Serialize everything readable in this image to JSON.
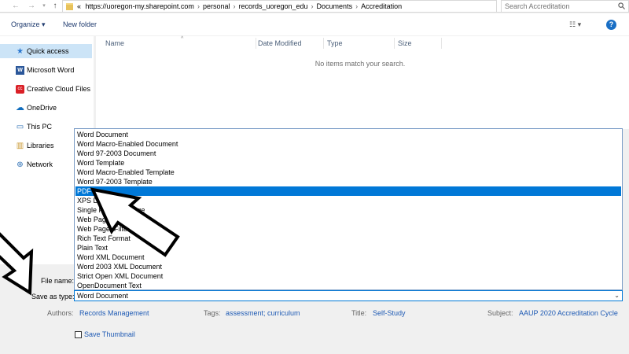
{
  "address": {
    "crumbs": [
      "https://uoregon-my.sharepoint.com",
      "personal",
      "records_uoregon_edu",
      "Documents",
      "Accreditation"
    ],
    "prefix": "«",
    "search_placeholder": "Search Accreditation"
  },
  "toolbar": {
    "organize": "Organize ▾",
    "new_folder": "New folder"
  },
  "sidebar": {
    "items": [
      {
        "label": "Quick access",
        "icon": "star-icon"
      },
      {
        "label": "Microsoft Word",
        "icon": "word-icon"
      },
      {
        "label": "Creative Cloud Files",
        "icon": "creative-cloud-icon"
      },
      {
        "label": "OneDrive",
        "icon": "cloud-icon"
      },
      {
        "label": "This PC",
        "icon": "computer-icon"
      },
      {
        "label": "Libraries",
        "icon": "library-icon"
      },
      {
        "label": "Network",
        "icon": "network-icon"
      }
    ]
  },
  "filelist": {
    "columns": [
      "Name",
      "Date Modified",
      "Type",
      "Size"
    ],
    "empty_message": "No items match your search."
  },
  "dropdown": {
    "options": [
      "Word Document",
      "Word Macro-Enabled Document",
      "Word 97-2003 Document",
      "Word Template",
      "Word Macro-Enabled Template",
      "Word 97-2003 Template",
      "PDF",
      "XPS Document",
      "Single File Web Page",
      "Web Page",
      "Web Page, Filtered",
      "Rich Text Format",
      "Plain Text",
      "Word XML Document",
      "Word 2003 XML Document",
      "Strict Open XML Document",
      "OpenDocument Text"
    ],
    "selected_index": 6
  },
  "form": {
    "file_name_label": "File name:",
    "save_as_label": "Save as type:",
    "save_as_value": "Word Document",
    "authors_label": "Authors:",
    "authors_value": "Records Management",
    "tags_label": "Tags:",
    "tags_value": "assessment; curriculum",
    "title_label": "Title:",
    "title_value": "Self-Study",
    "subject_label": "Subject:",
    "subject_value": "AAUP 2020 Accreditation Cycle",
    "thumbnail_label": "Save Thumbnail"
  },
  "colors": {
    "accent": "#0078d7",
    "link": "#1e5ab4",
    "selected_nav": "#cce4f7"
  }
}
